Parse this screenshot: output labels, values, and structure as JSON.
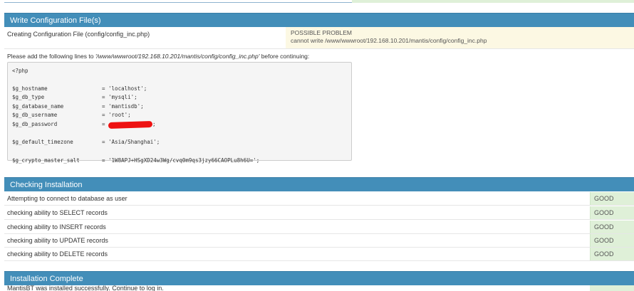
{
  "write_config": {
    "header": "Write Configuration File(s)",
    "creating_label": "Creating Configuration File (config/config_inc.php)",
    "problem_title": "POSSIBLE PROBLEM",
    "problem_detail": "cannot write /www/wwwroot/192.168.10.201/mantis/config/config_inc.php",
    "instruction_prefix": "Please add the following lines to ",
    "instruction_path": "'/www/wwwroot/192.168.10.201/mantis/config/config_inc.php'",
    "instruction_suffix": " before continuing:",
    "code": {
      "open_tag": "<?php",
      "lines": [
        {
          "key": "$g_hostname",
          "value": "= 'localhost';"
        },
        {
          "key": "$g_db_type",
          "value": "= 'mysqli';"
        },
        {
          "key": "$g_database_name",
          "value": "= 'mantisdb';"
        },
        {
          "key": "$g_db_username",
          "value": "= 'root';"
        },
        {
          "key": "$g_db_password",
          "value_prefix": "= ",
          "value_suffix": ";"
        },
        {
          "key": "$g_default_timezone",
          "value": "= 'Asia/Shanghai';"
        },
        {
          "key": "$g_crypto_master_salt",
          "value": "= '1W8APJ+HSgXD24w3Wg/cvq0m9qs3jzy66CAOPLu8h6U=';"
        }
      ]
    }
  },
  "checking": {
    "header": "Checking Installation",
    "rows": [
      {
        "label": "Attempting to connect to database as user",
        "status": "GOOD"
      },
      {
        "label": "checking ability to SELECT records",
        "status": "GOOD"
      },
      {
        "label": "checking ability to INSERT records",
        "status": "GOOD"
      },
      {
        "label": "checking ability to UPDATE records",
        "status": "GOOD"
      },
      {
        "label": "checking ability to DELETE records",
        "status": "GOOD"
      }
    ]
  },
  "complete": {
    "header": "Installation Complete",
    "partial_row_label": "MantisBT was installed successfully. Continue to log in."
  },
  "colors": {
    "header_bg": "#438eb9",
    "good_bg": "#dff0d8",
    "warning_bg": "#fcf8e3",
    "redaction": "#ee1111"
  }
}
